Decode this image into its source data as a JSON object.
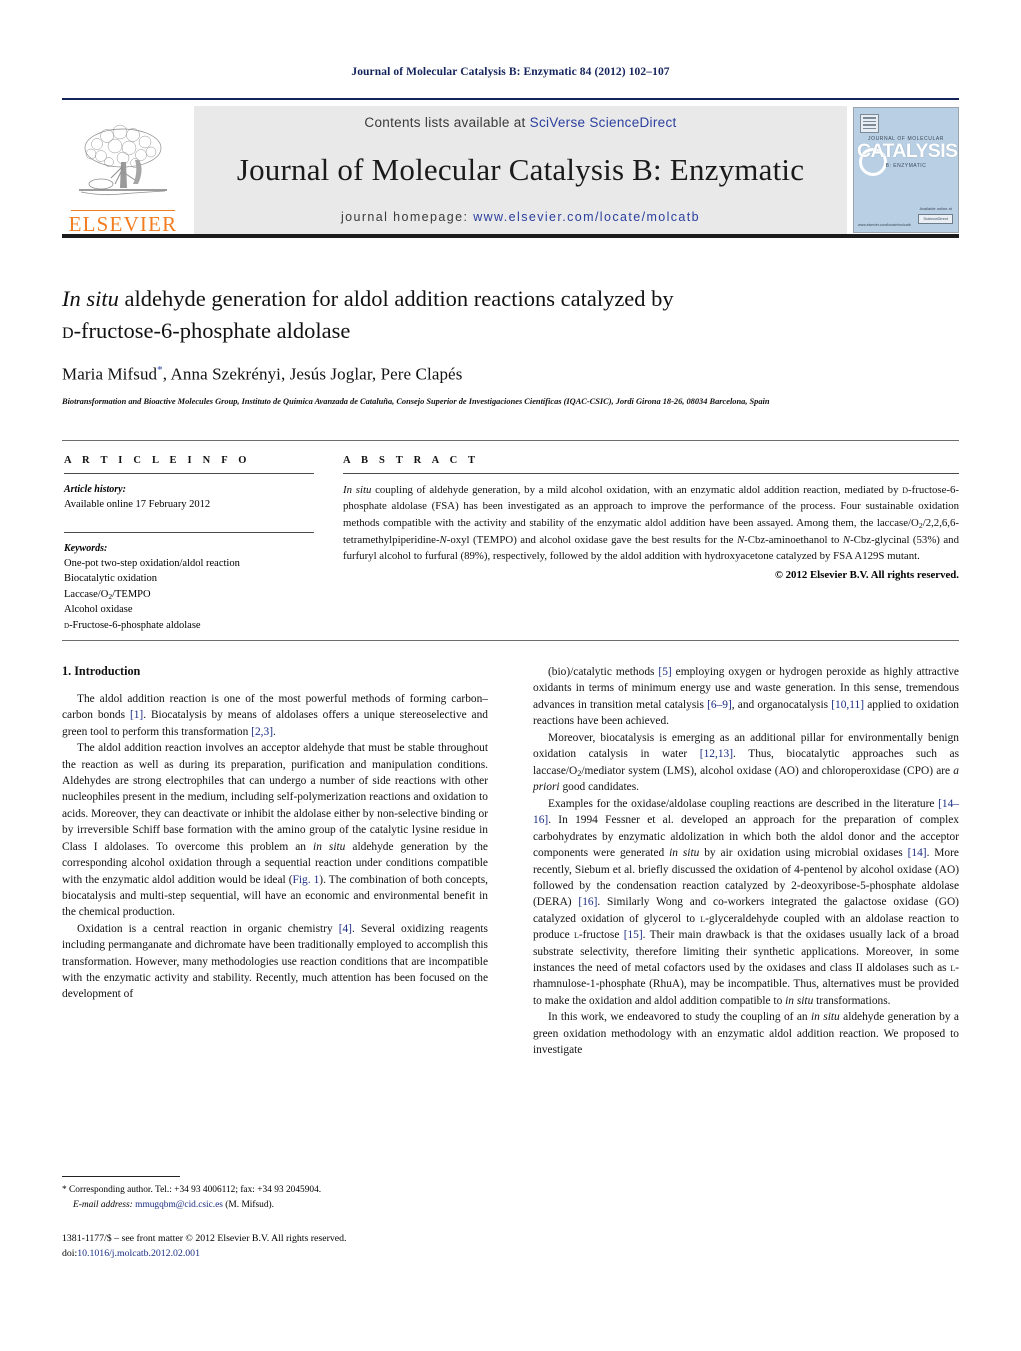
{
  "running_head": "Journal of Molecular Catalysis B: Enzymatic 84 (2012) 102–107",
  "masthead": {
    "contents_prefix": "Contents lists available at ",
    "contents_link": "SciVerse ScienceDirect",
    "journal_title": "Journal of Molecular Catalysis B: Enzymatic",
    "homepage_prefix": "journal homepage: ",
    "homepage_url": "www.elsevier.com/locate/molcatb",
    "publisher": "ELSEVIER",
    "cover": {
      "line_top": "JOURNAL OF MOLECULAR",
      "line_big": "CATALYSIS",
      "line_bottom": "B: ENZYMATIC",
      "foot_label": "Available online at",
      "foot_badge": "ScienceDirect",
      "foot_left": "www.elsevier.com/locate/molcatb"
    },
    "colors": {
      "rule_navy": "#13235b",
      "link_blue": "#2b3f9e",
      "elsevier_orange": "#f47c20",
      "band_grey": "#e9e9e9",
      "cover_blue": "#b9cfe4"
    }
  },
  "title": {
    "line1_italic": "In situ",
    "line1_rest": " aldehyde generation for aldol addition reactions catalyzed by",
    "line2_smallcaps": "d",
    "line2_rest": "-fructose-6-phosphate aldolase"
  },
  "authors": {
    "text": "Maria Mifsud",
    "star": "*",
    "rest": ", Anna Szekrényi, Jesús Joglar, Pere Clapés",
    "affiliation": "Biotransformation and Bioactive Molecules Group, Instituto de Química Avanzada de Cataluña, Consejo Superior de Investigaciones Científicas (IQAC-CSIC), Jordi Girona 18-26, 08034 Barcelona, Spain"
  },
  "article_info": {
    "heading": "A R T I C L E    I N F O",
    "history_label": "Article history:",
    "history_value": "Available online 17 February 2012",
    "keywords_label": "Keywords:",
    "keywords": [
      "One-pot two-step oxidation/aldol reaction",
      "Biocatalytic oxidation",
      "Laccase/O2/TEMPO",
      "Alcohol oxidase",
      "d-Fructose-6-phosphate aldolase"
    ]
  },
  "abstract": {
    "heading": "A B S T R A C T",
    "paragraph_parts": [
      {
        "t": "In situ",
        "s": "it"
      },
      {
        "t": " coupling of aldehyde generation, by a mild alcohol oxidation, with an enzymatic aldol addition reaction, mediated by ",
        "s": ""
      },
      {
        "t": "d",
        "s": "sc"
      },
      {
        "t": "-fructose-6-phosphate aldolase (FSA) has been investigated as an approach to improve the performance of the process. Four sustainable oxidation methods compatible with the activity and stability of the enzymatic aldol addition have been assayed. Among them, the laccase/O",
        "s": ""
      },
      {
        "t": "2",
        "s": "sub"
      },
      {
        "t": "/2,2,6,6-tetramethylpiperidine-",
        "s": ""
      },
      {
        "t": "N",
        "s": "it"
      },
      {
        "t": "-oxyl (TEMPO) and alcohol oxidase gave the best results for the ",
        "s": ""
      },
      {
        "t": "N",
        "s": "it"
      },
      {
        "t": "-Cbz-aminoethanol to ",
        "s": ""
      },
      {
        "t": "N",
        "s": "it"
      },
      {
        "t": "-Cbz-glycinal (53%) and furfuryl alcohol to furfural (89%), respectively, followed by the aldol addition with hydroxyacetone catalyzed by FSA A129S mutant.",
        "s": ""
      }
    ],
    "copyright": "© 2012 Elsevier B.V. All rights reserved."
  },
  "body": {
    "section_heading": "1.  Introduction",
    "left_paragraphs": [
      [
        {
          "t": "The aldol addition reaction is one of the most powerful methods of forming carbon–carbon bonds ",
          "s": ""
        },
        {
          "t": "[1]",
          "s": "ref"
        },
        {
          "t": ". Biocatalysis by means of aldolases offers a unique stereoselective and green tool to perform this transformation ",
          "s": ""
        },
        {
          "t": "[2,3]",
          "s": "ref"
        },
        {
          "t": ".",
          "s": ""
        }
      ],
      [
        {
          "t": "The aldol addition reaction involves an acceptor aldehyde that must be stable throughout the reaction as well as during its preparation, purification and manipulation conditions. Aldehydes are strong electrophiles that can undergo a number of side reactions with other nucleophiles present in the medium, including self-polymerization reactions and oxidation to acids. Moreover, they can deactivate or inhibit the aldolase either by non-selective binding or by irreversible Schiff base formation with the amino group of the catalytic lysine residue in Class I aldolases. To overcome this problem an ",
          "s": ""
        },
        {
          "t": "in situ",
          "s": "it"
        },
        {
          "t": " aldehyde generation by the corresponding alcohol oxidation through a sequential reaction under conditions compatible with the enzymatic aldol addition would be ideal (",
          "s": ""
        },
        {
          "t": "Fig. 1",
          "s": "ref"
        },
        {
          "t": "). The combination of both concepts, biocatalysis and multi-step sequential, will have an economic and environmental benefit in the chemical production.",
          "s": ""
        }
      ],
      [
        {
          "t": "Oxidation is a central reaction in organic chemistry ",
          "s": ""
        },
        {
          "t": "[4]",
          "s": "ref"
        },
        {
          "t": ". Several oxidizing reagents including permanganate and dichromate have been traditionally employed to accomplish this transformation. However, many methodologies use reaction conditions that are incompatible with the enzymatic activity and stability. Recently, much attention has been focused on the development of",
          "s": ""
        }
      ]
    ],
    "right_paragraphs": [
      [
        {
          "t": "(bio)/catalytic methods ",
          "s": ""
        },
        {
          "t": "[5]",
          "s": "ref"
        },
        {
          "t": " employing oxygen or hydrogen peroxide as highly attractive oxidants in terms of minimum energy use and waste generation. In this sense, tremendous advances in transition metal catalysis ",
          "s": ""
        },
        {
          "t": "[6–9]",
          "s": "ref"
        },
        {
          "t": ", and organocatalysis ",
          "s": ""
        },
        {
          "t": "[10,11]",
          "s": "ref"
        },
        {
          "t": " applied to oxidation reactions have been achieved.",
          "s": ""
        }
      ],
      [
        {
          "t": "Moreover, biocatalysis is emerging as an additional pillar for environmentally benign oxidation catalysis in water ",
          "s": ""
        },
        {
          "t": "[12,13]",
          "s": "ref"
        },
        {
          "t": ". Thus, biocatalytic approaches such as laccase/O",
          "s": ""
        },
        {
          "t": "2",
          "s": "sub"
        },
        {
          "t": "/mediator system (LMS), alcohol oxidase (AO) and chloroperoxidase (CPO) are ",
          "s": ""
        },
        {
          "t": "a priori",
          "s": "it"
        },
        {
          "t": " good candidates.",
          "s": ""
        }
      ],
      [
        {
          "t": "Examples for the oxidase/aldolase coupling reactions are described in the literature ",
          "s": ""
        },
        {
          "t": "[14–16]",
          "s": "ref"
        },
        {
          "t": ". In 1994 Fessner et al. developed an approach for the preparation of complex carbohydrates by enzymatic aldolization in which both the aldol donor and the acceptor components were generated ",
          "s": ""
        },
        {
          "t": "in situ",
          "s": "it"
        },
        {
          "t": " by air oxidation using microbial oxidases ",
          "s": ""
        },
        {
          "t": "[14]",
          "s": "ref"
        },
        {
          "t": ". More recently, Siebum et al. briefly discussed the oxidation of 4-pentenol by alcohol oxidase (AO) followed by the condensation reaction catalyzed by 2-deoxyribose-5-phosphate aldolase (DERA) ",
          "s": ""
        },
        {
          "t": "[16]",
          "s": "ref"
        },
        {
          "t": ". Similarly Wong and co-workers integrated the galactose oxidase (GO) catalyzed oxidation of glycerol to ",
          "s": ""
        },
        {
          "t": "l",
          "s": "sc"
        },
        {
          "t": "-glyceraldehyde coupled with an aldolase reaction to produce ",
          "s": ""
        },
        {
          "t": "l",
          "s": "sc"
        },
        {
          "t": "-fructose ",
          "s": ""
        },
        {
          "t": "[15]",
          "s": "ref"
        },
        {
          "t": ". Their main drawback is that the oxidases usually lack of a broad substrate selectivity, therefore limiting their synthetic applications. Moreover, in some instances the need of metal cofactors used by the oxidases and class II aldolases such as ",
          "s": ""
        },
        {
          "t": "l",
          "s": "sc"
        },
        {
          "t": "-rhamnulose-1-phosphate (RhuA), may be incompatible. Thus, alternatives must be provided to make the oxidation and aldol addition compatible to ",
          "s": ""
        },
        {
          "t": "in situ",
          "s": "it"
        },
        {
          "t": " transformations.",
          "s": ""
        }
      ],
      [
        {
          "t": "In this work, we endeavored to study the coupling of an ",
          "s": ""
        },
        {
          "t": "in situ",
          "s": "it"
        },
        {
          "t": " aldehyde generation by a green oxidation methodology with an enzymatic aldol addition reaction. We proposed to investigate",
          "s": ""
        }
      ]
    ]
  },
  "footnote": {
    "star": "*",
    "corresponding": " Corresponding author. Tel.: +34 93 4006112; fax: +34 93 2045904.",
    "email_label": "E-mail address:",
    "email": "mmugqbm@cid.csic.es",
    "email_suffix": " (M. Mifsud).",
    "issn_line": "1381-1177/$ – see front matter © 2012 Elsevier B.V. All rights reserved.",
    "doi_label": "doi:",
    "doi_value": "10.1016/j.molcatb.2012.02.001"
  }
}
